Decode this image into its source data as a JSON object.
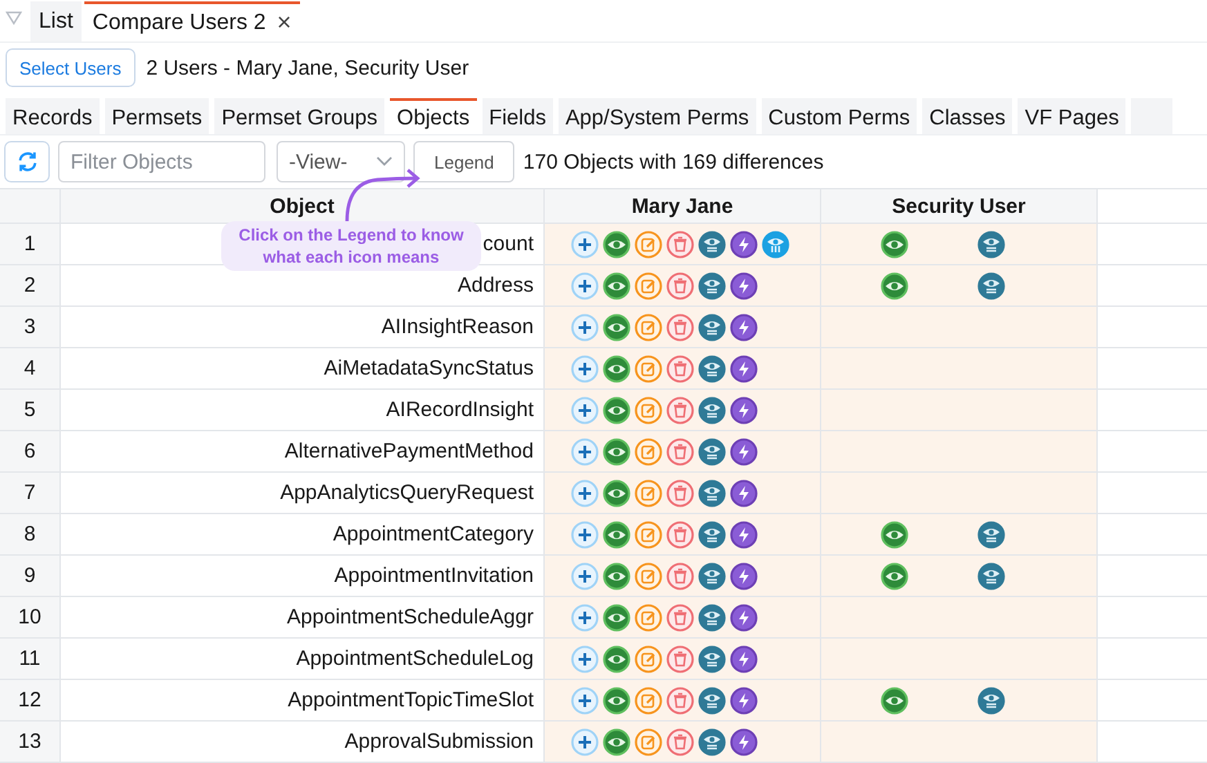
{
  "top_tabs": [
    {
      "label": "List",
      "selected": false
    },
    {
      "label": "Compare Users 2",
      "selected": true,
      "close": "×"
    }
  ],
  "select_users_button": "Select Users",
  "users_summary": "2 Users - Mary Jane, Security User",
  "section_tabs": [
    {
      "label": "Records",
      "selected": false
    },
    {
      "label": "Permsets",
      "selected": false
    },
    {
      "label": "Permset Groups",
      "selected": false
    },
    {
      "label": "Objects",
      "selected": true
    },
    {
      "label": "Fields",
      "selected": false
    },
    {
      "label": "App/System Perms",
      "selected": false
    },
    {
      "label": "Custom Perms",
      "selected": false
    },
    {
      "label": "Classes",
      "selected": false
    },
    {
      "label": "VF Pages",
      "selected": false
    }
  ],
  "filter": {
    "placeholder": "Filter Objects"
  },
  "view_select": "-View-",
  "legend_button": "Legend",
  "summary": "170 Objects with 169 differences",
  "tooltip": "Click on the Legend to know what each icon means",
  "table": {
    "columns": [
      "Object",
      "Mary Jane",
      "Security User"
    ],
    "rows": [
      {
        "index": "1",
        "object": "count",
        "user_1": {
          "create": true,
          "read": true,
          "edit": true,
          "delete": true,
          "view_all": true,
          "modify_all": true,
          "view_all_fields": true
        },
        "user_2": {
          "read": true,
          "view_all": true
        }
      },
      {
        "index": "2",
        "object": "Address",
        "user_1": {
          "create": true,
          "read": true,
          "edit": true,
          "delete": true,
          "view_all": true,
          "modify_all": true,
          "view_all_fields": false
        },
        "user_2": {
          "read": true,
          "view_all": true
        }
      },
      {
        "index": "3",
        "object": "AIInsightReason",
        "user_1": {
          "create": true,
          "read": true,
          "edit": true,
          "delete": true,
          "view_all": true,
          "modify_all": true,
          "view_all_fields": false
        },
        "user_2": {
          "read": false,
          "view_all": false
        }
      },
      {
        "index": "4",
        "object": "AiMetadataSyncStatus",
        "user_1": {
          "create": true,
          "read": true,
          "edit": true,
          "delete": true,
          "view_all": true,
          "modify_all": true,
          "view_all_fields": false
        },
        "user_2": {
          "read": false,
          "view_all": false
        }
      },
      {
        "index": "5",
        "object": "AIRecordInsight",
        "user_1": {
          "create": true,
          "read": true,
          "edit": true,
          "delete": true,
          "view_all": true,
          "modify_all": true,
          "view_all_fields": false
        },
        "user_2": {
          "read": false,
          "view_all": false
        }
      },
      {
        "index": "6",
        "object": "AlternativePaymentMethod",
        "user_1": {
          "create": true,
          "read": true,
          "edit": true,
          "delete": true,
          "view_all": true,
          "modify_all": true,
          "view_all_fields": false
        },
        "user_2": {
          "read": false,
          "view_all": false
        }
      },
      {
        "index": "7",
        "object": "AppAnalyticsQueryRequest",
        "user_1": {
          "create": true,
          "read": true,
          "edit": true,
          "delete": true,
          "view_all": true,
          "modify_all": true,
          "view_all_fields": false
        },
        "user_2": {
          "read": false,
          "view_all": false
        }
      },
      {
        "index": "8",
        "object": "AppointmentCategory",
        "user_1": {
          "create": true,
          "read": true,
          "edit": true,
          "delete": true,
          "view_all": true,
          "modify_all": true,
          "view_all_fields": false
        },
        "user_2": {
          "read": true,
          "view_all": true
        }
      },
      {
        "index": "9",
        "object": "AppointmentInvitation",
        "user_1": {
          "create": true,
          "read": true,
          "edit": true,
          "delete": true,
          "view_all": true,
          "modify_all": true,
          "view_all_fields": false
        },
        "user_2": {
          "read": true,
          "view_all": true
        }
      },
      {
        "index": "10",
        "object": "AppointmentScheduleAggr",
        "user_1": {
          "create": true,
          "read": true,
          "edit": true,
          "delete": true,
          "view_all": true,
          "modify_all": true,
          "view_all_fields": false
        },
        "user_2": {
          "read": false,
          "view_all": false
        }
      },
      {
        "index": "11",
        "object": "AppointmentScheduleLog",
        "user_1": {
          "create": true,
          "read": true,
          "edit": true,
          "delete": true,
          "view_all": true,
          "modify_all": true,
          "view_all_fields": false
        },
        "user_2": {
          "read": false,
          "view_all": false
        }
      },
      {
        "index": "12",
        "object": "AppointmentTopicTimeSlot",
        "user_1": {
          "create": true,
          "read": true,
          "edit": true,
          "delete": true,
          "view_all": true,
          "modify_all": true,
          "view_all_fields": false
        },
        "user_2": {
          "read": true,
          "view_all": true
        }
      },
      {
        "index": "13",
        "object": "ApprovalSubmission",
        "user_1": {
          "create": true,
          "read": true,
          "edit": true,
          "delete": true,
          "view_all": true,
          "modify_all": true,
          "view_all_fields": false
        },
        "user_2": {
          "read": false,
          "view_all": false
        }
      }
    ]
  }
}
